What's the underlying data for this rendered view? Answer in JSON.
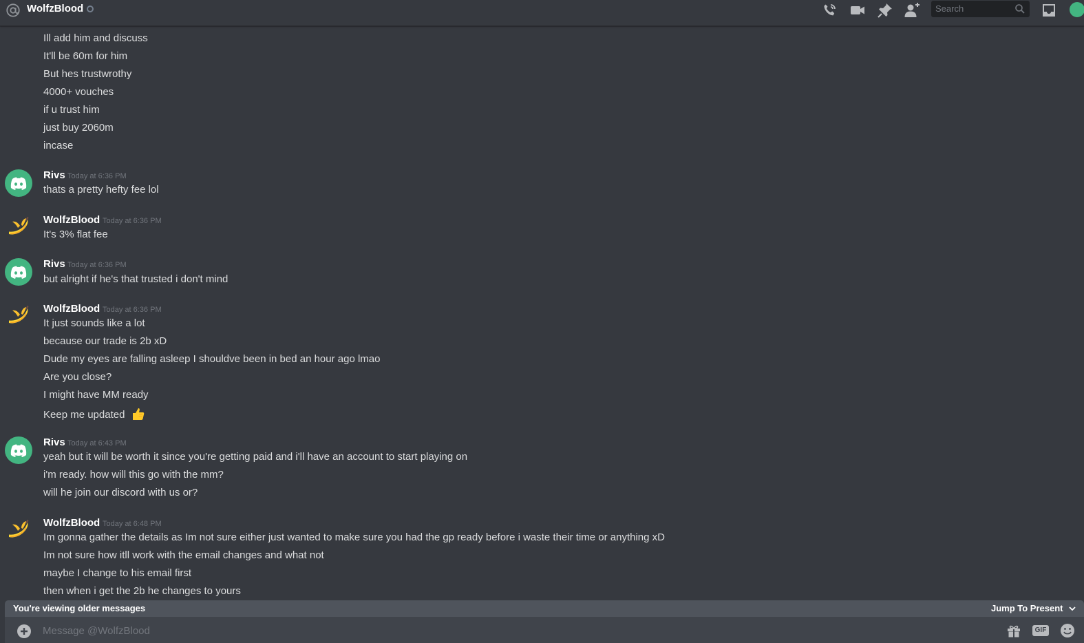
{
  "header": {
    "title": "WolfzBlood",
    "search_placeholder": "Search"
  },
  "messages": {
    "continued_lines": [
      "Ill add him and discuss",
      "It'll be 60m for him",
      "But hes trustwrothy",
      "4000+ vouches",
      "if u trust him",
      "just buy 2060m",
      "incase"
    ],
    "groups": [
      {
        "author": "Rivs",
        "avatar": "discord-logo-icon",
        "timestamp": "Today at 6:36 PM",
        "lines": [
          "thats a pretty hefty fee lol"
        ]
      },
      {
        "author": "WolfzBlood",
        "avatar": "banana-icon",
        "timestamp": "Today at 6:36 PM",
        "lines": [
          "It's 3% flat fee"
        ]
      },
      {
        "author": "Rivs",
        "avatar": "discord-logo-icon",
        "timestamp": "Today at 6:36 PM",
        "lines": [
          "but alright if he's that trusted i don't mind"
        ]
      },
      {
        "author": "WolfzBlood",
        "avatar": "banana-icon",
        "timestamp": "Today at 6:36 PM",
        "lines": [
          "It just sounds like a lot",
          "because our trade is 2b xD",
          "Dude my eyes are falling asleep I shouldve been in bed an hour ago lmao",
          "Are you close?",
          "I might have MM ready",
          "Keep me updated"
        ],
        "emoji": "thumbs-up-icon"
      },
      {
        "author": "Rivs",
        "avatar": "discord-logo-icon",
        "timestamp": "Today at 6:43 PM",
        "lines": [
          "yeah but it will be worth it since you're getting paid and i'll have an account to start playing on",
          "i'm ready. how will this go with the mm?",
          "will he join our discord with us or?"
        ]
      },
      {
        "author": "WolfzBlood",
        "avatar": "banana-icon",
        "timestamp": "Today at 6:48 PM",
        "lines": [
          "Im gonna gather the details as Im not sure either just wanted to make sure you had the gp ready before i waste their time or anything xD",
          "Im not sure how itll work with the email changes and what not",
          "maybe I change to his email first",
          "then when i get the 2b he changes to yours"
        ]
      }
    ]
  },
  "older_bar": {
    "text": "You're viewing older messages",
    "jump_label": "Jump To Present"
  },
  "composer": {
    "placeholder": "Message @WolfzBlood",
    "gif_label": "GIF"
  },
  "colors": {
    "background": "#36393f",
    "discord_green": "#43b581",
    "text": "#dcddde",
    "muted": "#72767d"
  }
}
